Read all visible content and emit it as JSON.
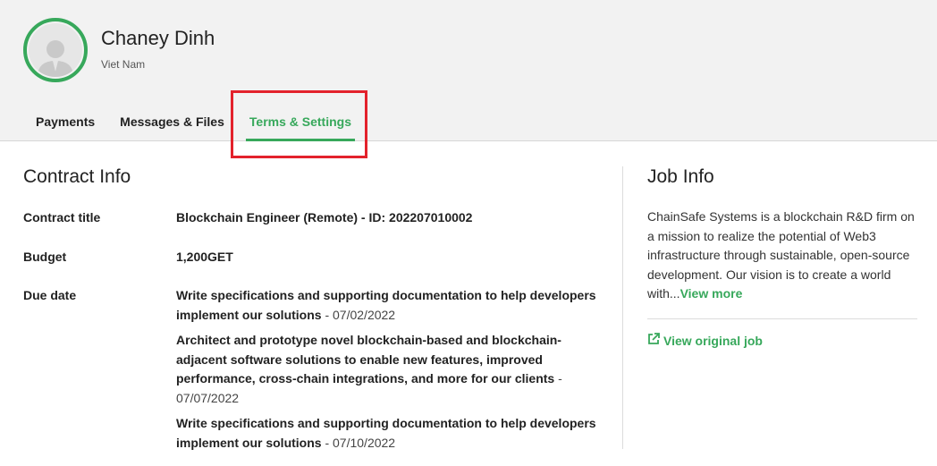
{
  "colors": {
    "accent": "#37a85b",
    "highlight": "#e3222c"
  },
  "profile": {
    "name": "Chaney Dinh",
    "country": "Viet Nam",
    "avatar_icon": "user-avatar-icon"
  },
  "tabs": [
    {
      "label": "Payments",
      "active": false
    },
    {
      "label": "Messages & Files",
      "active": false
    },
    {
      "label": "Terms & Settings",
      "active": true
    }
  ],
  "contract": {
    "heading": "Contract Info",
    "title_label": "Contract title",
    "title_value": "Blockchain Engineer (Remote) - ID: 202207010002",
    "budget_label": "Budget",
    "budget_value": "1,200GET",
    "due_label": "Due date",
    "milestones": [
      {
        "text": "Write specifications and supporting documentation to help developers implement our solutions",
        "date": " - 07/02/2022"
      },
      {
        "text": "Architect and prototype novel blockchain-based and blockchain-adjacent software solutions to enable new features, improved performance, cross-chain integrations, and more for our clients",
        "date": " - 07/07/2022"
      },
      {
        "text": "Write specifications and supporting documentation to help developers implement our solutions",
        "date": " - 07/10/2022"
      }
    ]
  },
  "job": {
    "heading": "Job Info",
    "description": "ChainSafe Systems is a blockchain R&D firm on a mission to realize the potential of Web3 infrastructure through sustainable, open-source development. Our vision is to create a world with...",
    "view_more": "View more",
    "view_original": "View original job",
    "external_icon": "external-link-icon"
  }
}
